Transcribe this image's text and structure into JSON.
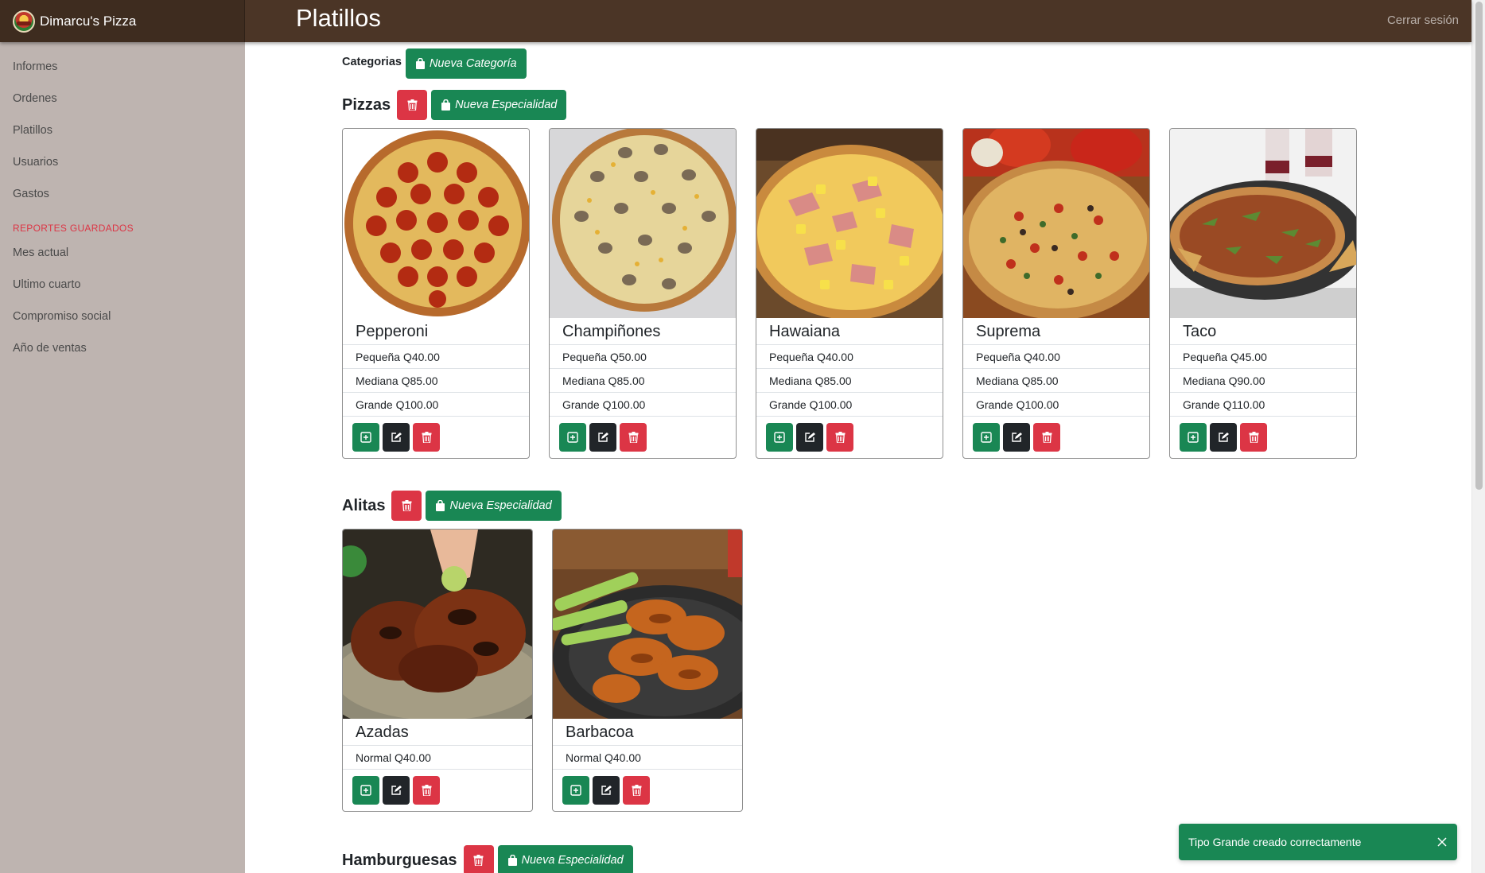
{
  "app": {
    "brand": "Dimarcu's Pizza",
    "page_title": "Platillos",
    "logout": "Cerrar sesión"
  },
  "sidebar": {
    "items": [
      {
        "label": "Informes"
      },
      {
        "label": "Ordenes"
      },
      {
        "label": "Platillos"
      },
      {
        "label": "Usuarios"
      },
      {
        "label": "Gastos"
      }
    ],
    "reports_heading": "REPORTES GUARDADOS",
    "reports": [
      {
        "label": "Mes actual"
      },
      {
        "label": "Ultimo cuarto"
      },
      {
        "label": "Compromiso social"
      },
      {
        "label": "Año de ventas"
      }
    ]
  },
  "categories": {
    "label": "Categorias",
    "new_button": "Nueva Categoría"
  },
  "sections": [
    {
      "title": "Pizzas",
      "new_button": "Nueva Especialidad",
      "items": [
        {
          "name": "Pepperoni",
          "image_icon": "pizza-pepperoni-image",
          "prices": [
            "Pequeña Q40.00",
            "Mediana Q85.00",
            "Grande Q100.00"
          ]
        },
        {
          "name": "Champiñones",
          "image_icon": "pizza-mushroom-image",
          "prices": [
            "Pequeña Q50.00",
            "Mediana Q85.00",
            "Grande Q100.00"
          ]
        },
        {
          "name": "Hawaiana",
          "image_icon": "pizza-hawaiian-image",
          "prices": [
            "Pequeña Q40.00",
            "Mediana Q85.00",
            "Grande Q100.00"
          ]
        },
        {
          "name": "Suprema",
          "image_icon": "pizza-supreme-image",
          "prices": [
            "Pequeña Q40.00",
            "Mediana Q85.00",
            "Grande Q100.00"
          ]
        },
        {
          "name": "Taco",
          "image_icon": "pizza-taco-image",
          "prices": [
            "Pequeña Q45.00",
            "Mediana Q90.00",
            "Grande Q110.00"
          ]
        }
      ]
    },
    {
      "title": "Alitas",
      "new_button": "Nueva Especialidad",
      "items": [
        {
          "name": "Azadas",
          "image_icon": "grilled-wings-image",
          "prices": [
            "Normal Q40.00"
          ]
        },
        {
          "name": "Barbacoa",
          "image_icon": "bbq-wings-image",
          "prices": [
            "Normal Q40.00"
          ]
        }
      ]
    },
    {
      "title": "Hamburguesas",
      "new_button": "Nueva Especialidad",
      "items": []
    }
  ],
  "toast": {
    "message": "Tipo Grande creado correctamente"
  },
  "colors": {
    "topbar": "#4b3526",
    "sidebar": "#beb4b0",
    "success": "#198754",
    "danger": "#dc3545",
    "dark": "#212529",
    "heading_accent": "#dc3545"
  }
}
